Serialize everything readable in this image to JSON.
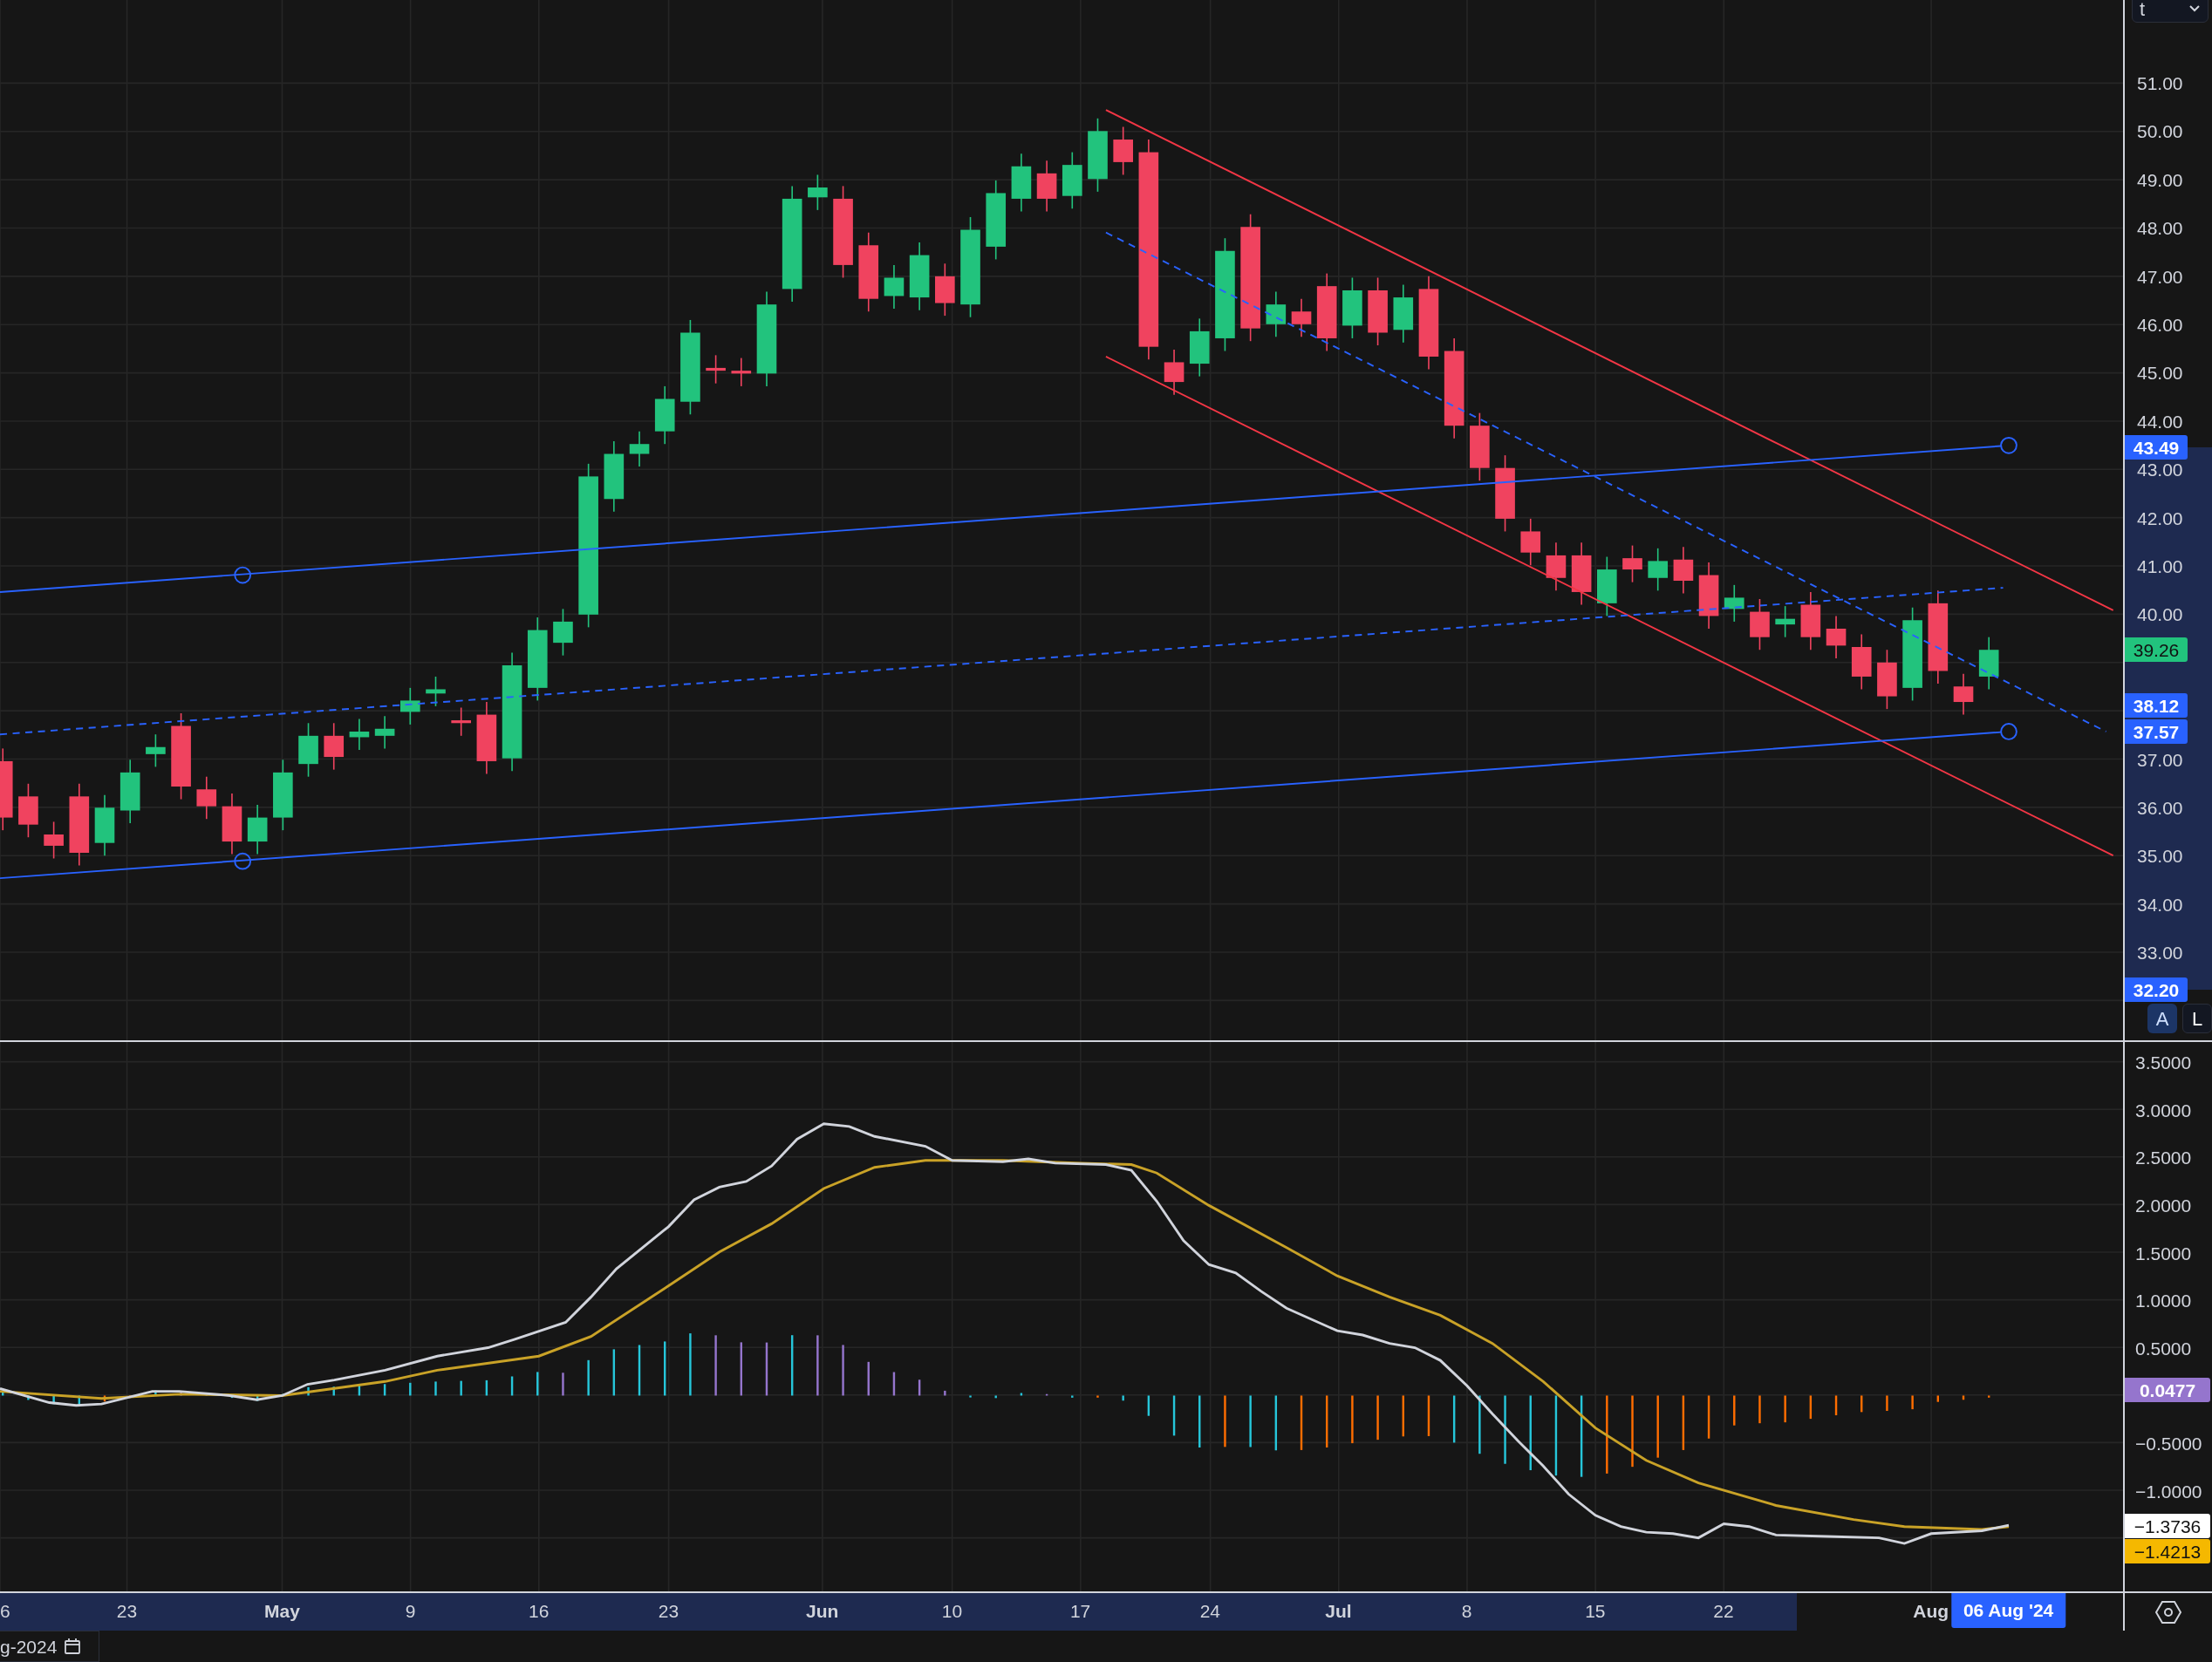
{
  "symbol_menu": {
    "label": "t"
  },
  "price_axis": {
    "ticks": [
      "51.00",
      "50.00",
      "49.00",
      "48.00",
      "47.00",
      "46.00",
      "45.00",
      "44.00",
      "43.00",
      "42.00",
      "41.00",
      "40.00",
      "37.00",
      "36.00",
      "35.00",
      "34.00",
      "33.00"
    ],
    "badges": [
      {
        "label": "43.49",
        "color": "#2962ff"
      },
      {
        "label": "39.26",
        "color": "#22c37d"
      },
      {
        "label": "38.12",
        "color": "#2962ff"
      },
      {
        "label": "37.57",
        "color": "#2962ff"
      },
      {
        "label": "32.20",
        "color": "#2962ff"
      }
    ]
  },
  "scale_buttons": [
    {
      "label": "A",
      "selected": true
    },
    {
      "label": "L",
      "selected": false
    }
  ],
  "macd_axis": {
    "ticks": [
      "3.5000",
      "3.0000",
      "2.5000",
      "2.0000",
      "1.5000",
      "1.0000",
      "0.5000",
      "−0.5000",
      "−1.0000"
    ],
    "badges": [
      {
        "label": "0.0477",
        "color": "#9575cd"
      },
      {
        "label": "−1.3736",
        "color": "#ffffff"
      },
      {
        "label": "−1.4213",
        "color": "#f5b800"
      }
    ]
  },
  "time_axis": {
    "labels": [
      {
        "label": "6",
        "kind": "day"
      },
      {
        "label": "23",
        "kind": "day"
      },
      {
        "label": "May",
        "kind": "month"
      },
      {
        "label": "9",
        "kind": "day"
      },
      {
        "label": "16",
        "kind": "day"
      },
      {
        "label": "23",
        "kind": "day"
      },
      {
        "label": "Jun",
        "kind": "month"
      },
      {
        "label": "10",
        "kind": "day"
      },
      {
        "label": "17",
        "kind": "day"
      },
      {
        "label": "24",
        "kind": "day"
      },
      {
        "label": "Jul",
        "kind": "month"
      },
      {
        "label": "8",
        "kind": "day"
      },
      {
        "label": "15",
        "kind": "day"
      },
      {
        "label": "22",
        "kind": "day"
      },
      {
        "label": "Aug",
        "kind": "month"
      }
    ],
    "crosshair_label": "06 Aug '24"
  },
  "date_field": {
    "value": "g-2024"
  }
}
